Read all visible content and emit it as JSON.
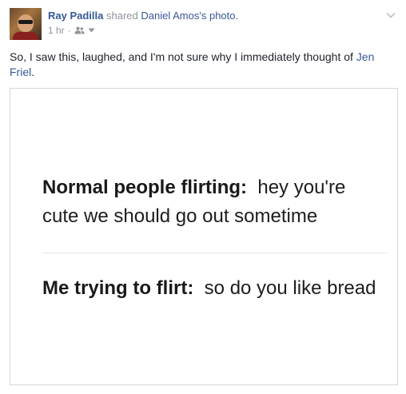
{
  "post": {
    "author": "Ray Padilla",
    "action": "shared",
    "owner": "Daniel Amos",
    "owner_suffix": "'s",
    "object": "photo.",
    "time": "1 hr",
    "separator": "·",
    "audience_icon": "friends-icon",
    "menu_icon": "chevron-down-icon",
    "text_before": "So, I saw this, laughed, and I'm not sure why I immediately thought of ",
    "mention": "Jen Friel",
    "text_after": "."
  },
  "image": {
    "line1_lead": "Normal people flirting:",
    "line1_rest": "hey you're cute we should go out sometime",
    "line2_lead": "Me trying to flirt:",
    "line2_rest": "so do you like bread"
  },
  "colors": {
    "link": "#365899",
    "muted": "#90949c",
    "text": "#1d2129"
  }
}
